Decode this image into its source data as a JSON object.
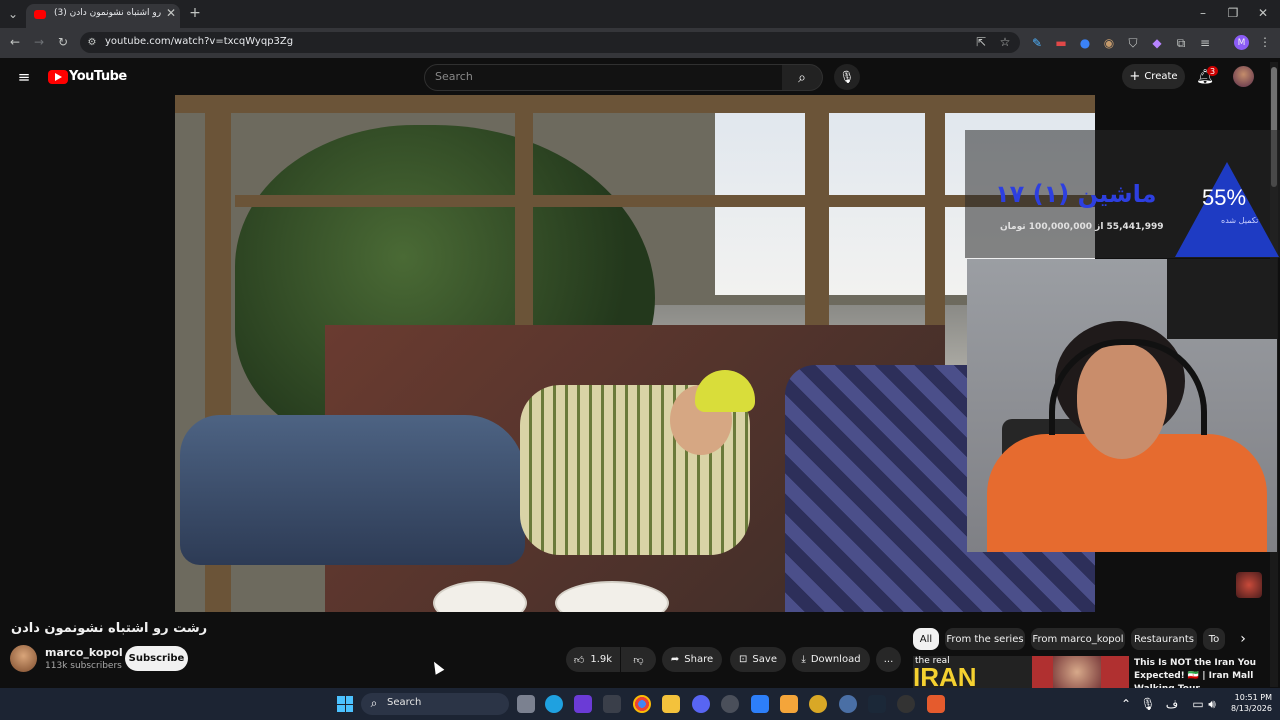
{
  "browser": {
    "tab_title": "رشت رو اشتباه نشونمون دادن (3)",
    "url": "youtube.com/watch?v=txcqWyqp3Zg"
  },
  "youtube": {
    "logo_text": "YouTube",
    "search_placeholder": "Search",
    "create_label": "Create",
    "notification_count": "3"
  },
  "overlay": {
    "percent": "55%",
    "title_fa": "ماشین (۱) ۱۷",
    "amounts": "55,441,999 از 100,000,000 تومان",
    "sub_fa": "تکمیل شده"
  },
  "video_info": {
    "title": "رشت رو اشتباه نشونمون دادن",
    "channel": "marco_kopol",
    "subscribers": "113k subscribers",
    "subscribe_label": "Subscribe",
    "likes": "1.9k",
    "share_label": "Share",
    "save_label": "Save",
    "download_label": "Download",
    "more_label": "..."
  },
  "chips": [
    "All",
    "From the series",
    "From marco_kopol",
    "Restaurants",
    "To"
  ],
  "recommended": {
    "thumb_text": "IRAN",
    "thumb_top_text": "the real",
    "title": "This Is NOT the Iran You Expected! 🇮🇷 | Iran Mall",
    "title_line2": "Walking Tour"
  },
  "taskbar": {
    "search_label": "Search",
    "time": "10:51 PM",
    "date": "8/13/2026"
  },
  "colors": {
    "yt_red": "#ff0000",
    "accent_blue": "#1f3fd6"
  }
}
